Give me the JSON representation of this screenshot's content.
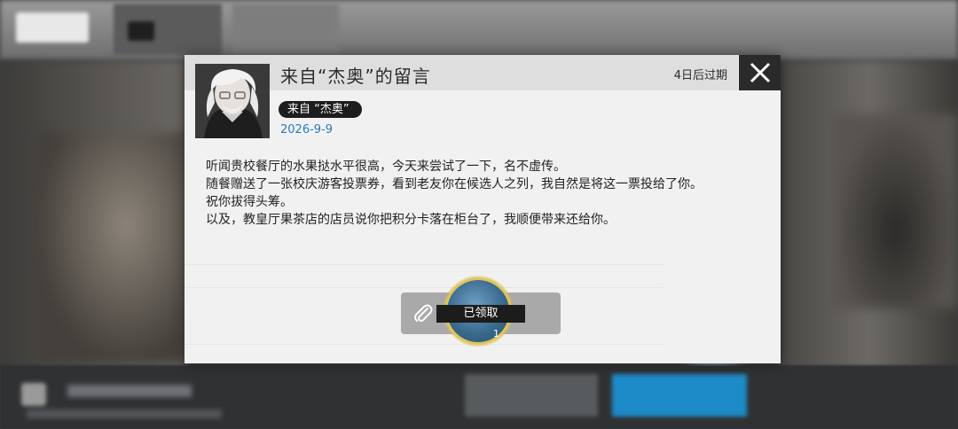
{
  "message": {
    "title": "来自“杰奥”的留言",
    "expire_text": "4日后过期",
    "sender_badge": "来自 “杰奥”",
    "date": "2026-9-9",
    "body_lines": [
      "听闻贵校餐厅的水果挞水平很高，今天来尝试了一下，名不虚传。",
      "随餐赠送了一张校庆游客投票券，看到老友你在候选人之列，我自然是将这一票投给了你。",
      "祝你拔得头筹。",
      "以及，教皇厅果茶店的店员说你把积分卡落在柜台了，我顺便带来还给你。"
    ]
  },
  "attachment": {
    "status_label": "已领取",
    "item_count": "1",
    "icons": {
      "attachment": "paperclip-icon",
      "close": "close-icon"
    }
  },
  "colors": {
    "accent_blue": "#2a79c2",
    "item_ring": "#e0c55a",
    "dark": "#1c1c1c"
  }
}
